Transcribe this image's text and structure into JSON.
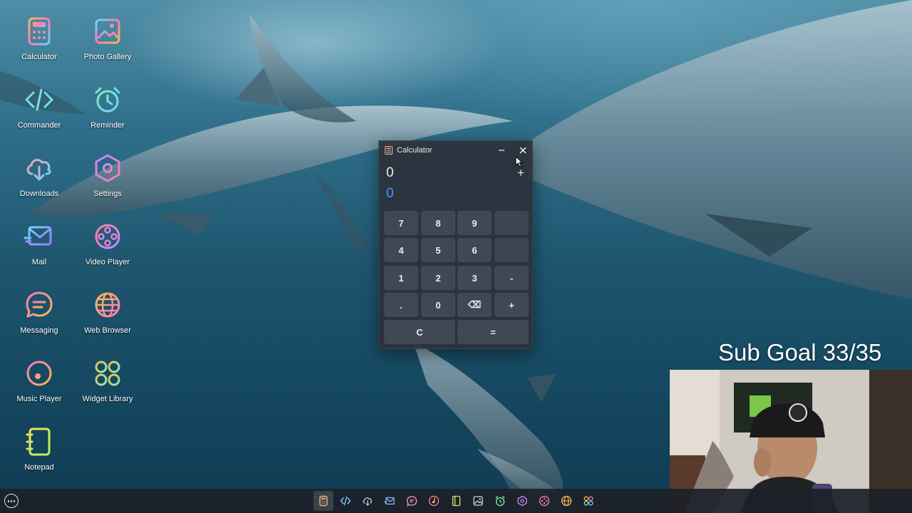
{
  "desktop": {
    "icons": [
      {
        "label": "Calculator",
        "icon": "calculator-icon"
      },
      {
        "label": "Photo Gallery",
        "icon": "photo-gallery-icon"
      },
      {
        "label": "Commander",
        "icon": "code-icon"
      },
      {
        "label": "Reminder",
        "icon": "alarm-clock-icon"
      },
      {
        "label": "Downloads",
        "icon": "cloud-download-icon"
      },
      {
        "label": "Settings",
        "icon": "hexagon-gear-icon"
      },
      {
        "label": "Mail",
        "icon": "mail-icon"
      },
      {
        "label": "Video Player",
        "icon": "film-reel-icon"
      },
      {
        "label": "Messaging",
        "icon": "chat-bubble-icon"
      },
      {
        "label": "Web Browser",
        "icon": "globe-icon"
      },
      {
        "label": "Music Player",
        "icon": "music-disc-icon"
      },
      {
        "label": "Widget Library",
        "icon": "widget-grid-icon"
      },
      {
        "label": "Notepad",
        "icon": "notepad-icon"
      }
    ]
  },
  "calculator": {
    "title": "Calculator",
    "expression": "0",
    "operator": "+",
    "result": "0",
    "keys": {
      "k7": "7",
      "k8": "8",
      "k9": "9",
      "k4": "4",
      "k5": "5",
      "k6": "6",
      "k1": "1",
      "k2": "2",
      "k3": "3",
      "minus": "-",
      "dot": ".",
      "k0": "0",
      "backspace": "⌫",
      "plus": "+",
      "clear": "C",
      "equals": "="
    }
  },
  "overlay": {
    "sub_goal": "Sub Goal 33/35"
  },
  "taskbar": {
    "apps": [
      "calculator-icon",
      "code-icon",
      "cloud-download-icon",
      "mail-icon",
      "chat-bubble-icon",
      "music-disc-icon",
      "notepad-icon",
      "photo-gallery-icon",
      "alarm-clock-icon",
      "hexagon-gear-icon",
      "film-reel-icon",
      "globe-icon",
      "widget-grid-icon"
    ],
    "active_app": "Calculator"
  },
  "colors": {
    "accent_blue": "#3aa0ff",
    "icon_gradient_start": "#f7b955",
    "icon_gradient_mid": "#ff7ab2",
    "icon_gradient_end": "#6fd3ff"
  }
}
